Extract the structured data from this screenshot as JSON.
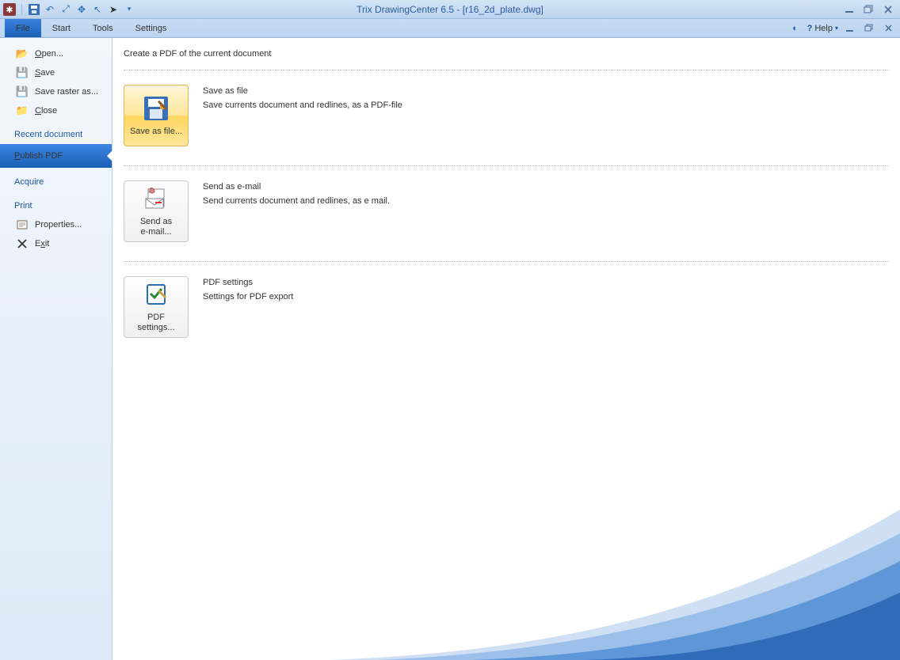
{
  "title": "Trix DrawingCenter 6.5 - [r16_2d_plate.dwg]",
  "menu": {
    "file": "File",
    "start": "Start",
    "tools": "Tools",
    "settings": "Settings",
    "help": "Help"
  },
  "sidebar": {
    "open": "Open...",
    "save": "Save",
    "saveraster": "Save raster as...",
    "close": "Close",
    "recent": "Recent document",
    "publish": "Publish PDF",
    "acquire": "Acquire",
    "print": "Print",
    "properties": "Properties...",
    "exit": "Exit"
  },
  "page": {
    "heading": "Create a PDF of the current document",
    "a1": {
      "btn": "Save as file...",
      "h": "Save as file",
      "d": "Save currents document and redlines, as a PDF-file"
    },
    "a2": {
      "btn": "Send as e‑mail...",
      "h": "Send as e-mail",
      "d": "Send currents document and redlines, as e mail."
    },
    "a3": {
      "btn": "PDF settings...",
      "h": "PDF settings",
      "d": "Settings for PDF export"
    }
  }
}
